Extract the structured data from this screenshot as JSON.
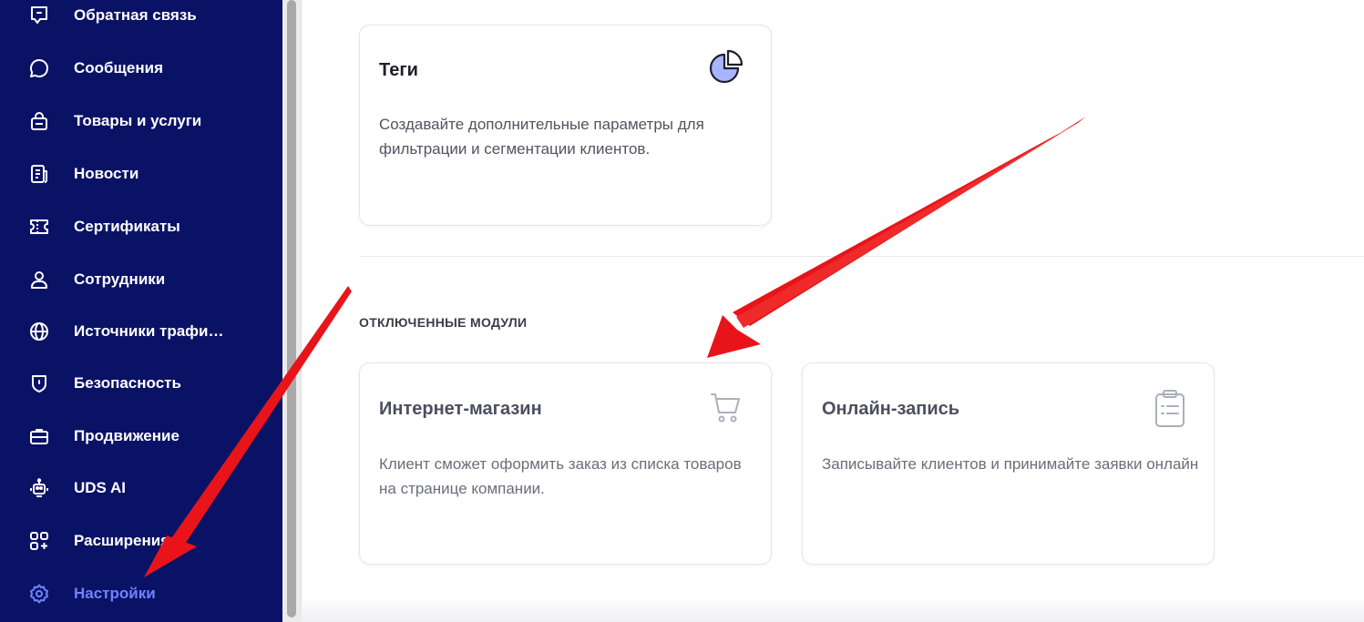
{
  "sidebar": {
    "items": [
      {
        "label": "Обратная связь",
        "icon": "feedback-icon"
      },
      {
        "label": "Сообщения",
        "icon": "chat-bubble-icon"
      },
      {
        "label": "Товары и услуги",
        "icon": "shopping-bag-icon"
      },
      {
        "label": "Новости",
        "icon": "newspaper-icon"
      },
      {
        "label": "Сертификаты",
        "icon": "ticket-icon"
      },
      {
        "label": "Сотрудники",
        "icon": "user-icon"
      },
      {
        "label": "Источники трафи…",
        "icon": "globe-icon"
      },
      {
        "label": "Безопасность",
        "icon": "shield-icon"
      },
      {
        "label": "Продвижение",
        "icon": "briefcase-icon"
      },
      {
        "label": "UDS AI",
        "icon": "robot-icon"
      },
      {
        "label": "Расширения",
        "icon": "apps-plus-icon"
      },
      {
        "label": "Настройки",
        "icon": "gear-icon",
        "active": true
      }
    ],
    "colors": {
      "background": "#0a1266",
      "text": "#ffffff",
      "active": "#6f83ff"
    }
  },
  "main": {
    "tags_card": {
      "title": "Теги",
      "description": "Создавайте дополнительные параметры для фильтрации и сегментации клиентов.",
      "icon": "pie-chart-icon"
    },
    "disabled_section": {
      "title": "ОТКЛЮЧЕННЫЕ МОДУЛИ",
      "cards": [
        {
          "title": "Интернет-магазин",
          "description": "Клиент сможет оформить заказ из списка товаров на странице компании.",
          "icon": "cart-icon"
        },
        {
          "title": "Онлайн-запись",
          "description": "Записывайте клиентов и принимайте заявки онлайн",
          "icon": "clipboard-icon"
        }
      ]
    }
  },
  "annotations": {
    "arrow_color": "#e8141a"
  }
}
